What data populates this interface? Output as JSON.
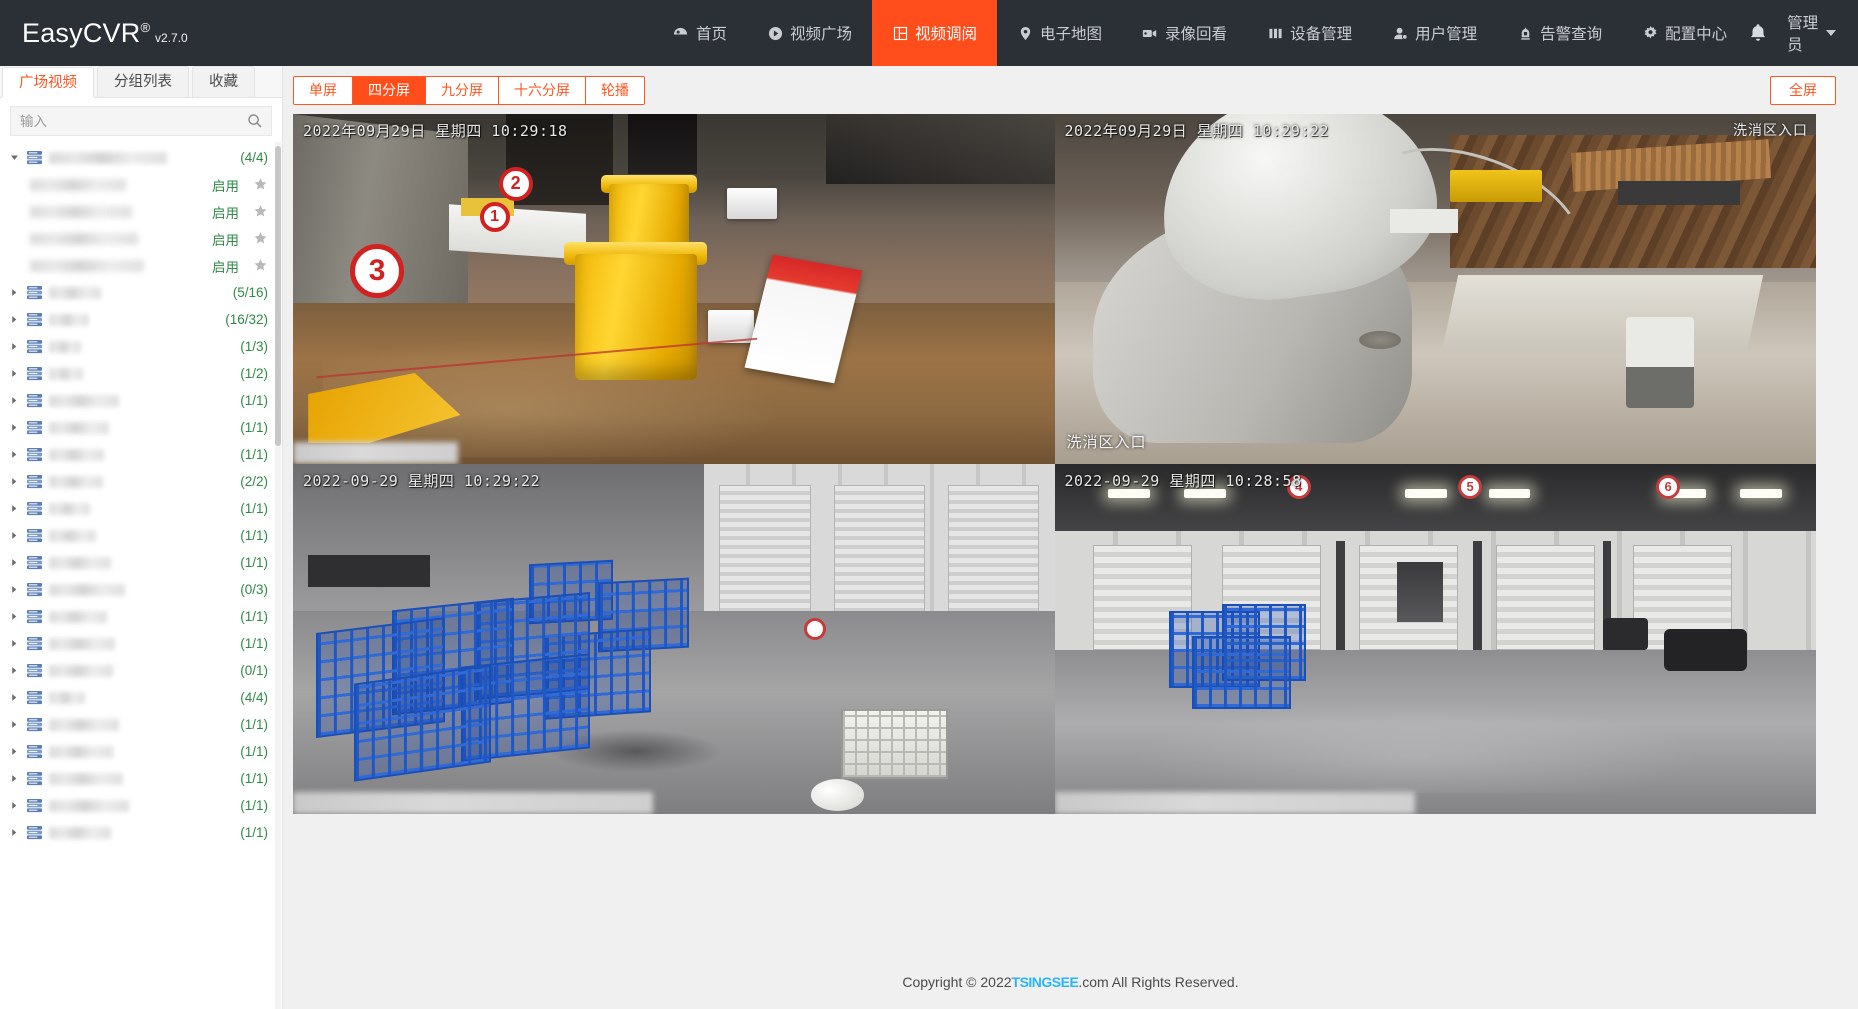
{
  "brand": {
    "name": "EasyCVR",
    "reg": "®",
    "version": "v2.7.0"
  },
  "nav": {
    "items": [
      {
        "label": "首页",
        "icon": "home-icon",
        "active": false
      },
      {
        "label": "视频广场",
        "icon": "play-circle-icon",
        "active": false
      },
      {
        "label": "视频调阅",
        "icon": "grid-layout-icon",
        "active": true
      },
      {
        "label": "电子地图",
        "icon": "map-pin-icon",
        "active": false
      },
      {
        "label": "录像回看",
        "icon": "video-camera-icon",
        "active": false
      },
      {
        "label": "设备管理",
        "icon": "bars-icon",
        "active": false
      },
      {
        "label": "用户管理",
        "icon": "user-icon",
        "active": false
      },
      {
        "label": "告警查询",
        "icon": "alarm-icon",
        "active": false
      },
      {
        "label": "配置中心",
        "icon": "gear-icon",
        "active": false
      }
    ],
    "bell_icon": "bell-icon",
    "user": "管理员",
    "user_caret": "chevron-down-icon"
  },
  "sidebar": {
    "tabs": [
      {
        "label": "广场视频",
        "active": true
      },
      {
        "label": "分组列表",
        "active": false
      },
      {
        "label": "收藏",
        "active": false
      }
    ],
    "search": {
      "placeholder": "输入",
      "value": "",
      "icon": "search-icon"
    },
    "tree": [
      {
        "count": "(4/4)",
        "expanded": true,
        "icon": "device-group-icon",
        "children": [
          {
            "status": "启用",
            "star": "star-icon"
          },
          {
            "status": "启用",
            "star": "star-icon"
          },
          {
            "status": "启用",
            "star": "star-icon"
          },
          {
            "status": "启用",
            "star": "star-icon"
          }
        ]
      },
      {
        "count": "(5/16)",
        "expanded": false,
        "icon": "device-group-icon",
        "children": []
      },
      {
        "count": "(16/32)",
        "expanded": false,
        "icon": "device-group-icon",
        "children": []
      },
      {
        "count": "(1/3)",
        "expanded": false,
        "icon": "device-group-icon",
        "children": []
      },
      {
        "count": "(1/2)",
        "expanded": false,
        "icon": "device-group-icon",
        "children": []
      },
      {
        "count": "(1/1)",
        "expanded": false,
        "icon": "device-group-icon",
        "children": []
      },
      {
        "count": "(1/1)",
        "expanded": false,
        "icon": "device-group-icon",
        "children": []
      },
      {
        "count": "(1/1)",
        "expanded": false,
        "icon": "device-group-icon",
        "children": []
      },
      {
        "count": "(2/2)",
        "expanded": false,
        "icon": "device-group-icon",
        "children": []
      },
      {
        "count": "(1/1)",
        "expanded": false,
        "icon": "device-group-icon",
        "children": []
      },
      {
        "count": "(1/1)",
        "expanded": false,
        "icon": "device-group-icon",
        "children": []
      },
      {
        "count": "(1/1)",
        "expanded": false,
        "icon": "device-group-icon",
        "children": []
      },
      {
        "count": "(0/3)",
        "expanded": false,
        "icon": "device-group-icon",
        "children": []
      },
      {
        "count": "(1/1)",
        "expanded": false,
        "icon": "device-group-icon",
        "children": []
      },
      {
        "count": "(1/1)",
        "expanded": false,
        "icon": "device-group-icon",
        "children": []
      },
      {
        "count": "(0/1)",
        "expanded": false,
        "icon": "device-group-icon",
        "children": []
      },
      {
        "count": "(4/4)",
        "expanded": false,
        "icon": "device-group-icon",
        "children": []
      },
      {
        "count": "(1/1)",
        "expanded": false,
        "icon": "device-group-icon",
        "children": []
      },
      {
        "count": "(1/1)",
        "expanded": false,
        "icon": "device-group-icon",
        "children": []
      },
      {
        "count": "(1/1)",
        "expanded": false,
        "icon": "device-group-icon",
        "children": []
      },
      {
        "count": "(1/1)",
        "expanded": false,
        "icon": "device-group-icon",
        "children": []
      },
      {
        "count": "(1/1)",
        "expanded": false,
        "icon": "device-group-icon",
        "children": []
      }
    ]
  },
  "toolbar": {
    "layouts": [
      {
        "label": "单屏",
        "active": false
      },
      {
        "label": "四分屏",
        "active": true
      },
      {
        "label": "九分屏",
        "active": false
      },
      {
        "label": "十六分屏",
        "active": false
      },
      {
        "label": "轮播",
        "active": false
      }
    ],
    "fullscreen_label": "全屏"
  },
  "video_grid": {
    "cells": [
      {
        "osd": "2022年09月29日  星期四  10:29:18",
        "corner_label": "",
        "bottom_label": "",
        "name_redacted": true
      },
      {
        "osd": "2022年09月29日  星期四  10:29:22",
        "corner_label": "洗消区入口",
        "bottom_label": "洗消区入口",
        "name_redacted": false
      },
      {
        "osd": "2022-09-29  星期四  10:29:22",
        "corner_label": "",
        "bottom_label": "",
        "name_redacted": true
      },
      {
        "osd": "2022-09-29  星期四  10:28:58",
        "corner_label": "",
        "bottom_label": "",
        "name_redacted": true
      }
    ]
  },
  "footer": {
    "prefix": "Copyright © 2022 ",
    "brand": "TSINGSEE",
    "suffix": ".com All Rights Reserved."
  },
  "colors": {
    "accent": "#ff4d1c",
    "accent_text": "#ff5722",
    "topbar_bg": "#2b2f36",
    "count_green": "#2e8b45",
    "tsingsee_blue": "#29b6f6"
  }
}
